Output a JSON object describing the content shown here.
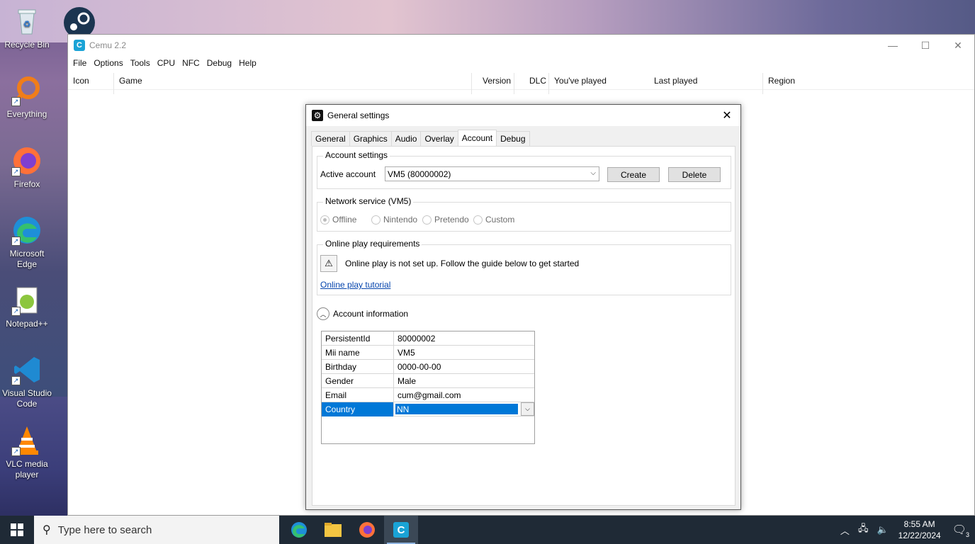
{
  "desktop": {
    "icons": [
      {
        "label": "Recycle Bin"
      },
      {
        "label": "Everything"
      },
      {
        "label": "Firefox"
      },
      {
        "label": "Microsoft Edge"
      },
      {
        "label": "Notepad++"
      },
      {
        "label": "Visual Studio Code"
      },
      {
        "label": "VLC media player"
      }
    ]
  },
  "app": {
    "title": "Cemu 2.2",
    "icon_letter": "C",
    "menu": [
      "File",
      "Options",
      "Tools",
      "CPU",
      "NFC",
      "Debug",
      "Help"
    ],
    "columns": [
      "Icon",
      "Game",
      "Version",
      "DLC",
      "You've played",
      "Last played",
      "Region"
    ]
  },
  "dialog": {
    "title": "General settings",
    "tabs": [
      "General",
      "Graphics",
      "Audio",
      "Overlay",
      "Account",
      "Debug"
    ],
    "active_tab": "Account",
    "account_settings": {
      "group_label": "Account settings",
      "active_account_label": "Active account",
      "active_account_value": "VM5 (80000002)",
      "create_label": "Create",
      "delete_label": "Delete"
    },
    "network_service": {
      "group_label": "Network service (VM5)",
      "options": [
        "Offline",
        "Nintendo",
        "Pretendo",
        "Custom"
      ],
      "selected": "Offline"
    },
    "online_play": {
      "group_label": "Online play requirements",
      "message": "Online play is not set up. Follow the guide below to get started",
      "link": "Online play tutorial"
    },
    "account_information": {
      "label": "Account information",
      "rows": [
        {
          "key": "PersistentId",
          "value": "80000002"
        },
        {
          "key": "Mii name",
          "value": "VM5"
        },
        {
          "key": "Birthday",
          "value": "0000-00-00"
        },
        {
          "key": "Gender",
          "value": "Male"
        },
        {
          "key": "Email",
          "value": "cum@gmail.com"
        },
        {
          "key": "Country",
          "value": "NN"
        }
      ],
      "selected_row": "Country"
    }
  },
  "taskbar": {
    "search_placeholder": "Type here to search",
    "time": "8:55 AM",
    "date": "12/22/2024",
    "notification_count": "3"
  }
}
